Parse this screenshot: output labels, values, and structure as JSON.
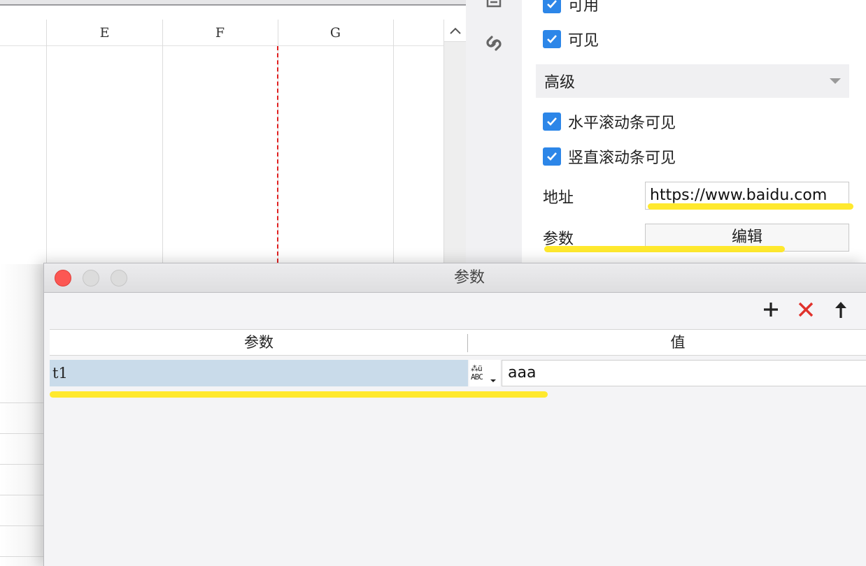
{
  "spreadsheet": {
    "columns": [
      "E",
      "F",
      "G"
    ]
  },
  "properties": {
    "checks_top": [
      {
        "label": "可用",
        "checked": true
      },
      {
        "label": "可见",
        "checked": true
      }
    ],
    "section_title": "高级",
    "checks_advanced": [
      {
        "label": "水平滚动条可见",
        "checked": true
      },
      {
        "label": "竖直滚动条可见",
        "checked": true
      }
    ],
    "address_label": "地址",
    "address_value": "https://www.baidu.com",
    "params_label": "参数",
    "edit_button": "编辑"
  },
  "dialog": {
    "title": "参数",
    "toolbar": {
      "add": "add-icon",
      "delete": "delete-icon",
      "move_up": "arrow-up-icon"
    },
    "columns": {
      "param": "参数",
      "value": "值"
    },
    "rows": [
      {
        "param": "t1",
        "type_top": "⁂ü",
        "type_bottom": "ABC",
        "value": "aaa"
      }
    ]
  },
  "colors": {
    "checkbox": "#2c86e8",
    "highlight": "#ffe92e",
    "selected_row": "#c9dbea",
    "close_button": "#fc5753",
    "delete_icon": "#e0312b",
    "page_break": "#e02020"
  }
}
